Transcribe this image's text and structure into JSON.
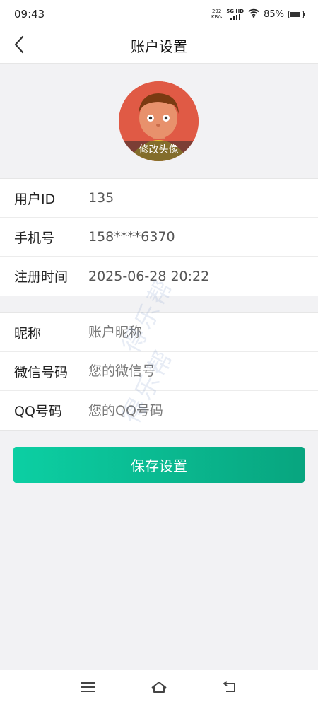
{
  "status_bar": {
    "time": "09:43",
    "net_speed_value": "292",
    "net_speed_unit": "KB/s",
    "signal_label": "5G HD",
    "battery": "85%",
    "battery_level": 0.85
  },
  "header": {
    "title": "账户设置",
    "back_icon": "chevron-left-icon"
  },
  "avatar": {
    "caption": "修改头像",
    "bg_color": "#e05a45"
  },
  "info_rows": [
    {
      "label": "用户ID",
      "value": "135"
    },
    {
      "label": "手机号",
      "value": "158****6370"
    },
    {
      "label": "注册时间",
      "value": "2025-06-28 20:22"
    }
  ],
  "form_rows": [
    {
      "label": "昵称",
      "value": "",
      "placeholder": "账户昵称"
    },
    {
      "label": "微信号码",
      "value": "",
      "placeholder": "您的微信号"
    },
    {
      "label": "QQ号码",
      "value": "",
      "placeholder": "您的QQ号码"
    }
  ],
  "save_button": {
    "label": "保存设置",
    "color_start": "#0ccfa3",
    "color_end": "#08a57f"
  },
  "watermark": {
    "text": "得乐帮"
  },
  "system_nav": {
    "menu_icon": "menu-icon",
    "home_icon": "home-icon",
    "back_icon": "back-icon"
  }
}
